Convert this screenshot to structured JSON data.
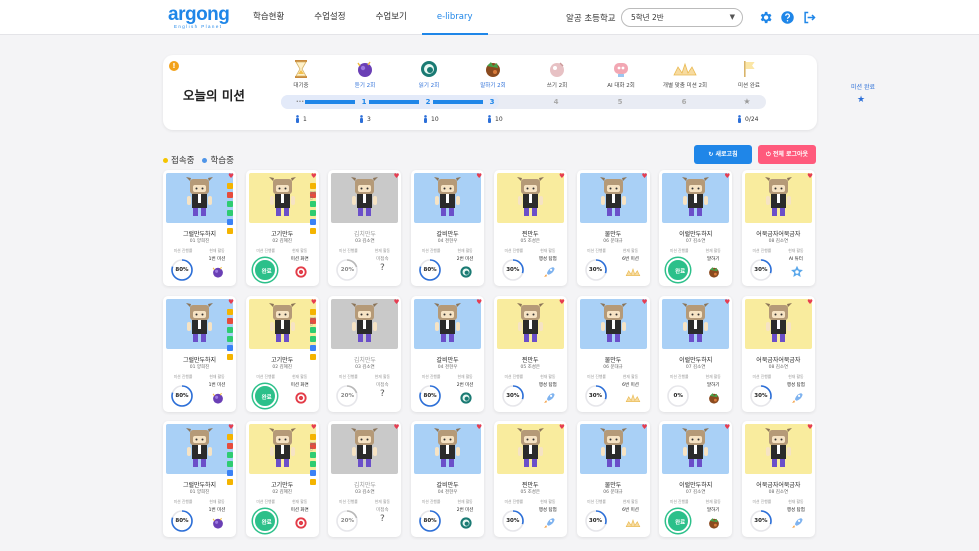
{
  "brand": {
    "name": "argong",
    "tagline": "English Planet",
    "color": "#1f86e8"
  },
  "nav": [
    {
      "label": "학습현황",
      "active": false
    },
    {
      "label": "수업설정",
      "active": false
    },
    {
      "label": "수업보기",
      "active": false
    },
    {
      "label": "e-library",
      "active": true
    }
  ],
  "header": {
    "school": "알공 초등학교",
    "class_selected": "5학년 2반",
    "icons": [
      "gear-icon",
      "help-icon",
      "logout-icon"
    ]
  },
  "mission": {
    "title": "오늘의 미션",
    "alert": "!",
    "stages": [
      {
        "label": "대기중",
        "icon": "hourglass-icon",
        "count": "1"
      },
      {
        "label": "듣기 2회",
        "icon": "listening-planet-icon",
        "count": "3"
      },
      {
        "label": "읽기 2회",
        "icon": "reading-planet-icon",
        "count": "10"
      },
      {
        "label": "말하기 2회",
        "icon": "speaking-planet-icon",
        "count": "10"
      },
      {
        "label": "쓰기 2회",
        "icon": "writing-planet-icon"
      },
      {
        "label": "AI 대화 2회",
        "icon": "ai-chat-icon"
      },
      {
        "label": "개별 맞춤 미션 2회",
        "icon": "custom-mission-icon"
      },
      {
        "label": "미션 완료",
        "icon": "flag-icon",
        "count": "0/24"
      }
    ],
    "steps": [
      "1",
      "2",
      "3",
      "4",
      "5",
      "6"
    ],
    "steps_done": 3,
    "dots": "···",
    "side_label": "미션 완료",
    "side_star": "★"
  },
  "toolbar": {
    "legend": [
      {
        "label": "접속중",
        "color": "#f5c400"
      },
      {
        "label": "학습중",
        "color": "#4f95e8"
      }
    ],
    "refresh_label": "새로고침",
    "logout_all_label": "전체 로그아웃"
  },
  "card_labels": {
    "progress": "미션 진행률",
    "next": "현재 활동",
    "ranking": "우리반"
  },
  "students": [
    {
      "name": "그럴만두하지",
      "number": "01 양희진",
      "bg": "blue",
      "progress": 80,
      "status": "",
      "next": "1번 미션",
      "next_icon": "listening-planet-icon",
      "badges": true,
      "ranking": false
    },
    {
      "name": "고기만두",
      "number": "02 김혜진",
      "bg": "yellow",
      "progress": 100,
      "status": "완료",
      "next": "미션 화면",
      "next_icon": "target-icon",
      "badges": true,
      "ranking": true
    },
    {
      "name": "김치만두",
      "number": "03 김소연",
      "bg": "gray",
      "progress": 20,
      "status": "",
      "next": "미접속",
      "next_icon": "",
      "badges": false,
      "ranking": false,
      "offline": true
    },
    {
      "name": "갈비만두",
      "number": "04 천현우",
      "bg": "blue",
      "progress": 80,
      "status": "",
      "next": "2번 미션",
      "next_icon": "reading-planet-icon",
      "badges": false,
      "ranking": false
    },
    {
      "name": "찐만두",
      "number": "05 조성은",
      "bg": "yellow",
      "progress": 30,
      "status": "",
      "next": "행성 탐험",
      "next_icon": "rocket-icon",
      "badges": false,
      "ranking": false
    },
    {
      "name": "물만두",
      "number": "06 문대규",
      "bg": "blue",
      "progress": 30,
      "status": "",
      "next": "6번 미션",
      "next_icon": "custom-mission-icon",
      "badges": false,
      "ranking": false
    },
    {
      "name": "이럴만두하지",
      "number": "07 김소연",
      "bg": "blue",
      "progress": 100,
      "status": "완료",
      "next": "말하기",
      "next_icon": "speaking-planet-icon",
      "badges": false,
      "ranking": false
    },
    {
      "name": "어묵금자어묵금자",
      "number": "08 김소연",
      "bg": "yellow",
      "progress": 30,
      "status": "",
      "next": "AI 튜터",
      "next_icon": "ai-tutor-icon",
      "badges": false,
      "ranking": false
    },
    {
      "name": "그럴만두하지",
      "number": "01 양희진",
      "bg": "blue",
      "progress": 80,
      "status": "",
      "next": "1번 미션",
      "next_icon": "listening-planet-icon",
      "badges": true,
      "ranking": false
    },
    {
      "name": "고기만두",
      "number": "02 김혜진",
      "bg": "yellow",
      "progress": 100,
      "status": "완료",
      "next": "미션 화면",
      "next_icon": "target-icon",
      "badges": true,
      "ranking": true
    },
    {
      "name": "김치만두",
      "number": "03 김소연",
      "bg": "gray",
      "progress": 20,
      "status": "",
      "next": "미접속",
      "next_icon": "",
      "badges": false,
      "ranking": false,
      "offline": true
    },
    {
      "name": "갈비만두",
      "number": "04 천현우",
      "bg": "blue",
      "progress": 80,
      "status": "",
      "next": "2번 미션",
      "next_icon": "reading-planet-icon",
      "badges": false,
      "ranking": false
    },
    {
      "name": "찐만두",
      "number": "05 조성은",
      "bg": "yellow",
      "progress": 30,
      "status": "",
      "next": "행성 탐험",
      "next_icon": "rocket-icon",
      "badges": false,
      "ranking": false
    },
    {
      "name": "물만두",
      "number": "06 문대규",
      "bg": "blue",
      "progress": 30,
      "status": "",
      "next": "6번 미션",
      "next_icon": "custom-mission-icon",
      "badges": false,
      "ranking": false
    },
    {
      "name": "이럴만두하지",
      "number": "07 김소연",
      "bg": "blue",
      "progress": 0,
      "status": "",
      "next": "말하기",
      "next_icon": "speaking-planet-icon",
      "badges": false,
      "ranking": false
    },
    {
      "name": "어묵금자어묵금자",
      "number": "08 김소연",
      "bg": "yellow",
      "progress": 30,
      "status": "",
      "next": "행성 탐험",
      "next_icon": "rocket-icon",
      "badges": false,
      "ranking": false
    },
    {
      "name": "그럴만두하지",
      "number": "01 양희진",
      "bg": "blue",
      "progress": 80,
      "status": "",
      "next": "1번 미션",
      "next_icon": "listening-planet-icon",
      "badges": true,
      "ranking": false
    },
    {
      "name": "고기만두",
      "number": "02 김혜진",
      "bg": "yellow",
      "progress": 100,
      "status": "완료",
      "next": "미션 화면",
      "next_icon": "target-icon",
      "badges": true,
      "ranking": true
    },
    {
      "name": "김치만두",
      "number": "03 김소연",
      "bg": "gray",
      "progress": 20,
      "status": "",
      "next": "미접속",
      "next_icon": "",
      "badges": false,
      "ranking": false,
      "offline": true
    },
    {
      "name": "갈비만두",
      "number": "04 천현우",
      "bg": "blue",
      "progress": 80,
      "status": "",
      "next": "2번 미션",
      "next_icon": "reading-planet-icon",
      "badges": false,
      "ranking": false
    },
    {
      "name": "찐만두",
      "number": "05 조성은",
      "bg": "yellow",
      "progress": 30,
      "status": "",
      "next": "행성 탐험",
      "next_icon": "rocket-icon",
      "badges": false,
      "ranking": false
    },
    {
      "name": "물만두",
      "number": "06 문대규",
      "bg": "blue",
      "progress": 30,
      "status": "",
      "next": "6번 미션",
      "next_icon": "custom-mission-icon",
      "badges": false,
      "ranking": false
    },
    {
      "name": "이럴만두하지",
      "number": "07 김소연",
      "bg": "blue",
      "progress": 100,
      "status": "완료",
      "next": "말하기",
      "next_icon": "speaking-planet-icon",
      "badges": false,
      "ranking": false
    },
    {
      "name": "어묵금자어묵금자",
      "number": "08 김소연",
      "bg": "yellow",
      "progress": 30,
      "status": "",
      "next": "행성 탐험",
      "next_icon": "rocket-icon",
      "badges": false,
      "ranking": false
    }
  ]
}
